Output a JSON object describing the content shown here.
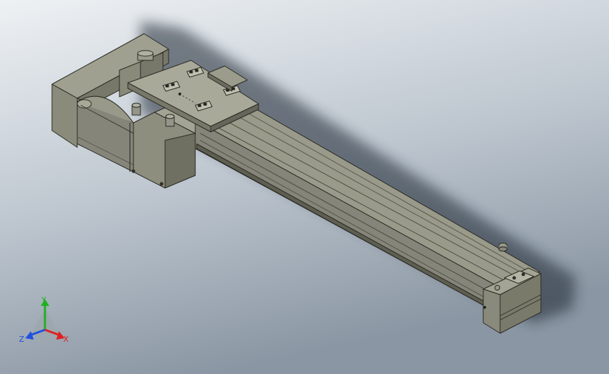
{
  "viewport": {
    "background_top": "#e9edf1",
    "background_bottom": "#8e9aa7",
    "part_face_top": "#9a9a8a",
    "part_face_front": "#82826f",
    "part_face_side": "#6d6d5d",
    "edge_color": "#2a2a22"
  },
  "triad": {
    "x_label": "X",
    "y_label": "Y",
    "z_label": "Z",
    "x_color": "#e02020",
    "y_color": "#20b020",
    "z_color": "#2050e0"
  }
}
